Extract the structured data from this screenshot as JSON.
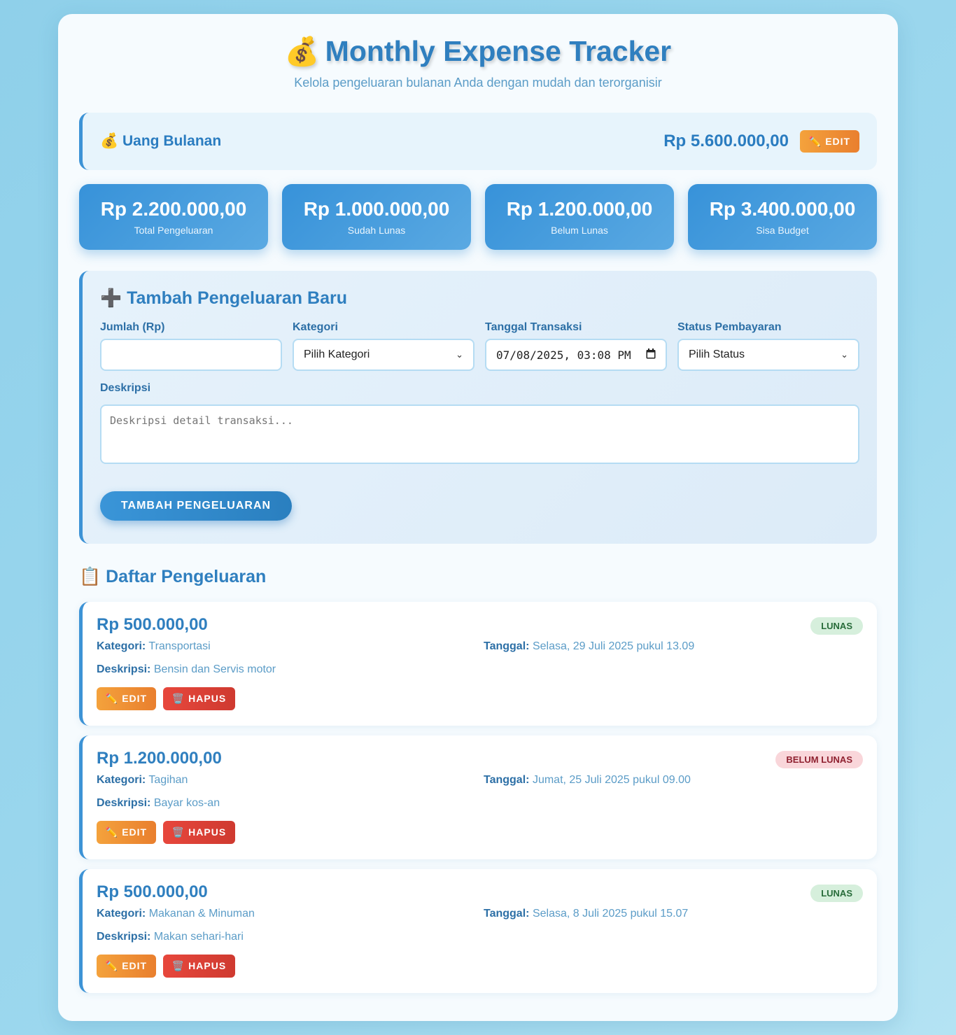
{
  "header": {
    "emoji": "💰",
    "title": "Monthly Expense Tracker",
    "subtitle": "Kelola pengeluaran bulanan Anda dengan mudah dan terorganisir"
  },
  "budget": {
    "label": "💰 Uang Bulanan",
    "amount": "Rp 5.600.000,00",
    "edit_label": "✏️ EDIT"
  },
  "stats": [
    {
      "value": "Rp 2.200.000,00",
      "label": "Total Pengeluaran"
    },
    {
      "value": "Rp 1.000.000,00",
      "label": "Sudah Lunas"
    },
    {
      "value": "Rp 1.200.000,00",
      "label": "Belum Lunas"
    },
    {
      "value": "Rp 3.400.000,00",
      "label": "Sisa Budget"
    }
  ],
  "form": {
    "title": "➕ Tambah Pengeluaran Baru",
    "amount_label": "Jumlah (Rp)",
    "amount_value": "",
    "category_label": "Kategori",
    "category_selected": "Pilih Kategori",
    "date_label": "Tanggal Transaksi",
    "date_value": "07/08/2025, 03:08 PM",
    "status_label": "Status Pembayaran",
    "status_selected": "Pilih Status",
    "description_label": "Deskripsi",
    "description_placeholder": "Deskripsi detail transaksi...",
    "submit_label": "TAMBAH PENGELUARAN"
  },
  "list": {
    "title": "📋 Daftar Pengeluaran",
    "labels": {
      "category": "Kategori:",
      "date": "Tanggal:",
      "description": "Deskripsi:"
    },
    "edit_label": "✏️ EDIT",
    "delete_label": "🗑️ HAPUS",
    "items": [
      {
        "amount": "Rp 500.000,00",
        "status": "LUNAS",
        "category": "Transportasi",
        "date": "Selasa, 29 Juli 2025 pukul 13.09",
        "description": "Bensin dan Servis motor"
      },
      {
        "amount": "Rp 1.200.000,00",
        "status": "BELUM LUNAS",
        "category": "Tagihan",
        "date": "Jumat, 25 Juli 2025 pukul 09.00",
        "description": "Bayar kos-an"
      },
      {
        "amount": "Rp 500.000,00",
        "status": "LUNAS",
        "category": "Makanan & Minuman",
        "date": "Selasa, 8 Juli 2025 pukul 15.07",
        "description": "Makan sehari-hari"
      }
    ]
  },
  "colors": {
    "accent": "#3d93d6",
    "paid_bg": "#d6efdc",
    "unpaid_bg": "#f9d6da",
    "edit": "#f4a23c",
    "delete": "#e7473c"
  }
}
